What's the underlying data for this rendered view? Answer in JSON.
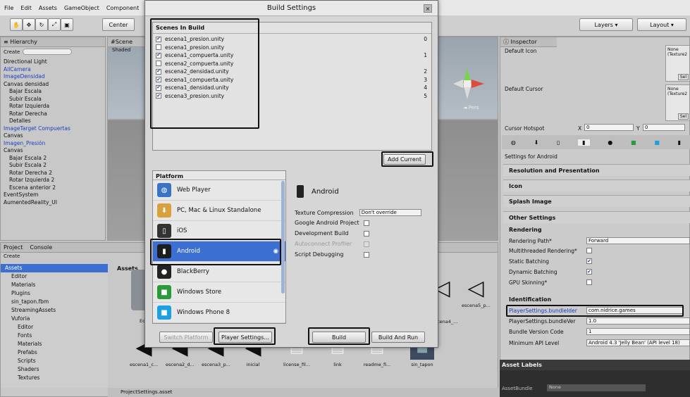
{
  "menu": [
    "File",
    "Edit",
    "Assets",
    "GameObject",
    "Component"
  ],
  "toolbar": {
    "center": "Center",
    "layers": "Layers",
    "layout": "Layout"
  },
  "hierarchy": {
    "tab": "Hierarchy",
    "create": "Create",
    "items": [
      "Directional Light",
      "AllCamera",
      "ImageDensidad",
      "Canvas densidad",
      "Bajar Escala",
      "Subir Escala",
      "Rotar Izquierda",
      "Rotar Derecha",
      "Detalles",
      "ImageTarget Compuertas",
      "Canvas",
      "Imagen_Presión",
      "Canvas",
      "Bajar Escala 2",
      "Subir Escala 2",
      "Rotar Derecha 2",
      "Rotar Izquierda 2",
      "Escena anterior 2",
      "EventSystem",
      "AumentedReality_UI"
    ]
  },
  "scene": {
    "tab": "Scene",
    "shaded": "Shaded"
  },
  "project": {
    "tab_project": "Project",
    "tab_console": "Console",
    "create": "Create",
    "tree": [
      "Assets",
      "Editor",
      "Materials",
      "Plugins",
      "sin_tapon.fbm",
      "StreamingAssets",
      "Vuforia",
      "Editor",
      "Fonts",
      "Materials",
      "Prefabs",
      "Scripts",
      "Shaders",
      "Textures"
    ],
    "breadcrumb": "Assets",
    "assets_top": [
      "Ed",
      "escena4_...",
      "escena5_p..."
    ],
    "assets_bottom": [
      "escena1_c...",
      "escena2_d...",
      "escena3_p...",
      "inicial",
      "license_fil...",
      "link",
      "readme_fi...",
      "sin_tapon"
    ],
    "status": "ProjectSettings.asset"
  },
  "dialog": {
    "title": "Build Settings",
    "scenes_header": "Scenes In Build",
    "scenes": [
      {
        "name": "escena1_presion.unity",
        "checked": true,
        "index": "0"
      },
      {
        "name": "escena1_presion.unity",
        "checked": false,
        "index": ""
      },
      {
        "name": "escena1_compuerta.unity",
        "checked": true,
        "index": "1"
      },
      {
        "name": "escena2_compuerta.unity",
        "checked": false,
        "index": ""
      },
      {
        "name": "escena2_densidad.unity",
        "checked": true,
        "index": "2"
      },
      {
        "name": "escena1_compuerta.unity",
        "checked": true,
        "index": "3"
      },
      {
        "name": "escena1_densidad.unity",
        "checked": true,
        "index": "4"
      },
      {
        "name": "escena3_presion.unity",
        "checked": true,
        "index": "5"
      }
    ],
    "add_current": "Add Current",
    "platform_header": "Platform",
    "platforms": [
      "Web Player",
      "PC, Mac & Linux Standalone",
      "iOS",
      "Android",
      "BlackBerry",
      "Windows Store",
      "Windows Phone 8"
    ],
    "selected_platform": "Android",
    "texture_compression_label": "Texture Compression",
    "texture_compression_value": "Don't override",
    "options": [
      "Google Android Project",
      "Development Build",
      "Autoconnect Profiler",
      "Script Debugging"
    ],
    "switch_platform": "Switch Platform",
    "player_settings": "Player Settings...",
    "build": "Build",
    "build_and_run": "Build And Run"
  },
  "inspector": {
    "tab": "Inspector",
    "default_icon": "Default Icon",
    "default_cursor": "Default Cursor",
    "cursor_hotspot": "Cursor Hotspot",
    "hotspot_x_label": "X",
    "hotspot_x": "0",
    "hotspot_y_label": "Y",
    "hotspot_y": "0",
    "none_texture": "None (Texture2",
    "select": "Sel",
    "settings_for": "Settings for Android",
    "sections": [
      "Resolution and Presentation",
      "Icon",
      "Splash Image",
      "Other Settings"
    ],
    "rendering": "Rendering",
    "rendering_path_label": "Rendering Path*",
    "rendering_path_value": "Forward",
    "multithreaded": "Multithreaded Rendering*",
    "static_batching": "Static Batching",
    "dynamic_batching": "Dynamic Batching",
    "gpu_skinning": "GPU Skinning*",
    "identification": "Identification",
    "bundle_identifier_label": "PlayerSettings.bundleIder",
    "bundle_identifier_value": "com.nidrice.games",
    "bundle_version_label": "PlayerSettings.bundleVer",
    "bundle_version_value": "1.0",
    "bundle_version_code_label": "Bundle Version Code",
    "bundle_version_code_value": "1",
    "min_api_label": "Minimum API Level",
    "min_api_value": "Android 4.3 'Jelly Bean' (API level 18)",
    "asset_labels": "Asset Labels",
    "asset_bundle": "AssetBundle",
    "asset_bundle_value": "None"
  },
  "colors": {
    "selection": "#3b6fd1",
    "highlight_box": "#111111"
  }
}
